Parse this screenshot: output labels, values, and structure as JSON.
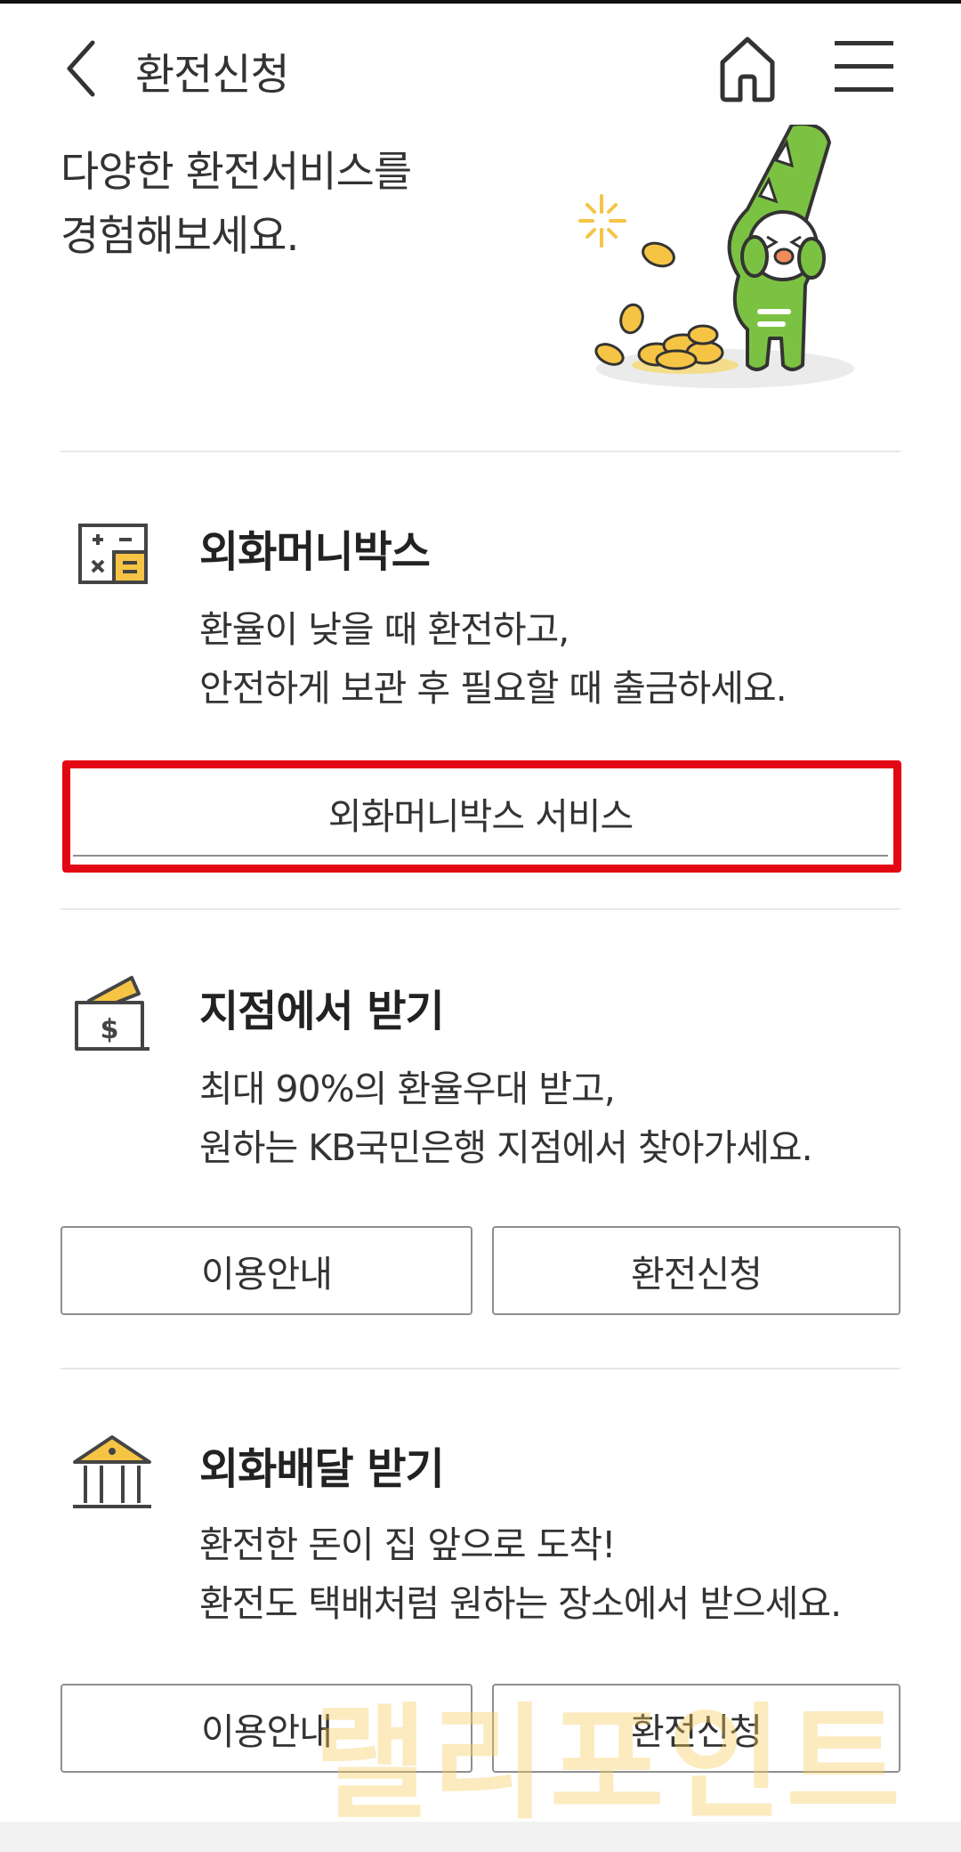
{
  "header": {
    "title": "환전신청",
    "back_icon": "chevron-left-icon",
    "home_icon": "home-icon",
    "menu_icon": "hamburger-menu-icon"
  },
  "intro": {
    "line1": "다양한 환전서비스를",
    "line2": "경험해보세요."
  },
  "services": [
    {
      "icon": "calculator-icon",
      "title": "외화머니박스",
      "desc_line1": "환율이 낮을 때 환전하고,",
      "desc_line2": "안전하게 보관 후 필요할 때 출금하세요.",
      "button": "외화머니박스 서비스"
    },
    {
      "icon": "wallet-dollar-icon",
      "title": "지점에서 받기",
      "desc_line1": "최대 90%의 환율우대 받고,",
      "desc_line2": "원하는 KB국민은행 지점에서 찾아가세요.",
      "button_info": "이용안내",
      "button_apply": "환전신청"
    },
    {
      "icon": "bank-building-icon",
      "title": "외화배달 받기",
      "desc_line1": "환전한 돈이 집 앞으로 도착!",
      "desc_line2": "환전도 택배처럼 원하는 장소에서 받으세요.",
      "button_info": "이용안내",
      "button_apply": "환전신청"
    }
  ],
  "watermark": "랠리포인트",
  "colors": {
    "accent_yellow": "#f6c445",
    "highlight_red": "#e30613",
    "mascot_green": "#7cc242"
  }
}
